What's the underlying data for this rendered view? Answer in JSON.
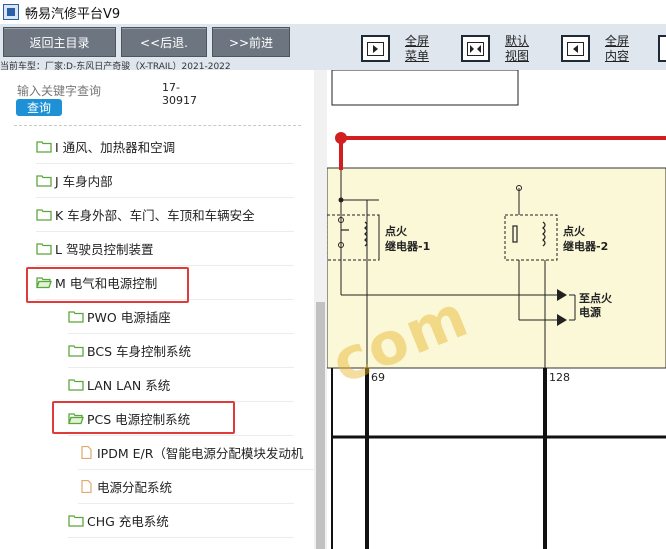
{
  "window": {
    "title": "畅易汽修平台V9"
  },
  "toolbar": {
    "home": "返回主目录",
    "back": "<<后退.",
    "forward": ">>前进",
    "btn1": {
      "line1": "全屏",
      "line2": "菜单",
      "icon": "show-menu-icon"
    },
    "btn2": {
      "line1": "默认",
      "line2": "视图",
      "icon": "default-view-icon"
    },
    "btn3": {
      "line1": "全屏",
      "line2": "内容",
      "icon": "fullscreen-content-icon"
    }
  },
  "vehicle": "当前车型：厂家:D-东风日产奇骏（X-TRAIL）2021-2022",
  "search": {
    "placeholder": "输入关键字查询",
    "value": "17-30917",
    "button": "查询"
  },
  "tree": [
    {
      "label": "I 通风、加热器和空调",
      "type": "folder"
    },
    {
      "label": "J 车身内部",
      "type": "folder"
    },
    {
      "label": "K 车身外部、车门、车顶和车辆安全",
      "type": "folder"
    },
    {
      "label": "L 驾驶员控制装置",
      "type": "folder"
    },
    {
      "label": "M 电气和电源控制",
      "type": "folder-open",
      "highlighted": true
    },
    {
      "label": "PWO 电源插座",
      "type": "folder"
    },
    {
      "label": "BCS 车身控制系统",
      "type": "folder"
    },
    {
      "label": "LAN LAN 系统",
      "type": "folder"
    },
    {
      "label": "PCS 电源控制系统",
      "type": "folder-open",
      "highlighted": true
    },
    {
      "label": "IPDM E/R（智能电源分配模块发动机",
      "type": "doc"
    },
    {
      "label": "电源分配系统",
      "type": "doc"
    },
    {
      "label": "CHG 充电系统",
      "type": "folder"
    }
  ],
  "diagram": {
    "relay1": {
      "line1": "点火",
      "line2": "继电器-1"
    },
    "relay2": {
      "line1": "点火",
      "line2": "继电器-2"
    },
    "to_ignition": {
      "line1": "至点火",
      "line2": "电源"
    },
    "pin_left": "69",
    "pin_right": "128",
    "watermark": "com"
  },
  "colors": {
    "highlight": "#e03b3b",
    "toolbar_button": "#6d7680",
    "wire_red": "#d11f1f",
    "fuse_box": "#fbf8d8"
  }
}
